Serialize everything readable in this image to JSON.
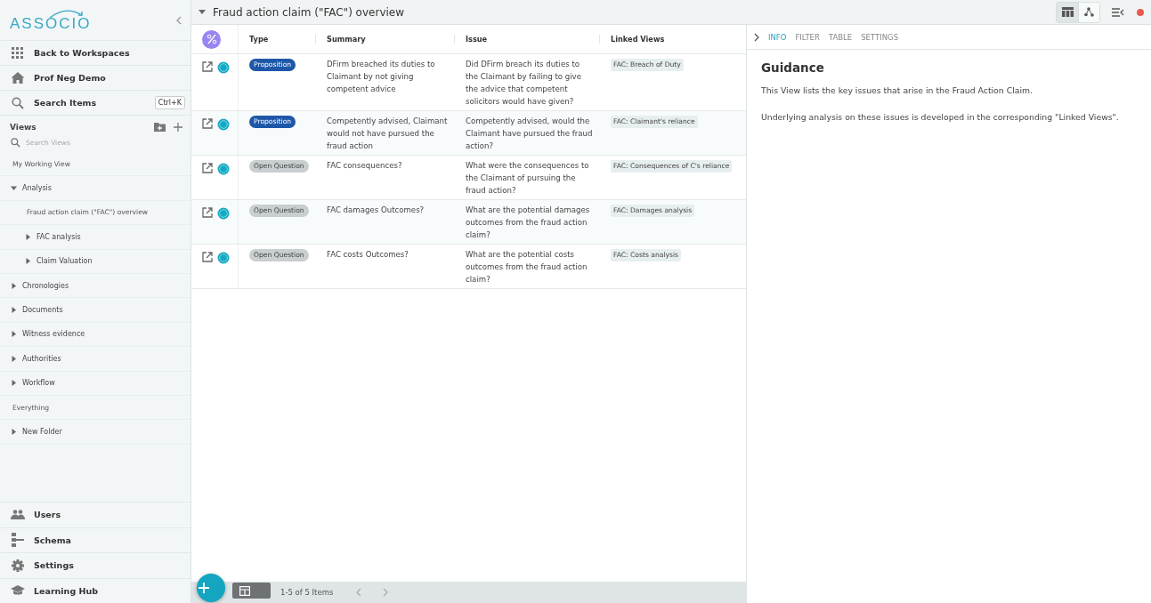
{
  "sidebar": {
    "logo": "ASSOCIO",
    "nav": [
      {
        "label": "Back to Workspaces",
        "kind": "grid"
      },
      {
        "label": "Prof Neg Demo",
        "kind": "home"
      },
      {
        "label": "Search Items",
        "kind": "search",
        "shortcut": "Ctrl+K"
      }
    ],
    "views_title": "Views",
    "views_search": {
      "placeholder": "Search Views"
    },
    "tree": [
      {
        "label": "My Working View",
        "kind": "view"
      },
      {
        "label": "Analysis",
        "kind": "folder",
        "expanded": true,
        "children": [
          {
            "label": "Fraud action claim (\"FAC\") overview",
            "kind": "view"
          },
          {
            "label": "FAC analysis",
            "kind": "folder",
            "expanded": false
          },
          {
            "label": "Claim Valuation",
            "kind": "folder",
            "expanded": false
          }
        ]
      },
      {
        "label": "Chronologies",
        "kind": "folder",
        "expanded": false
      },
      {
        "label": "Documents",
        "kind": "folder",
        "expanded": false
      },
      {
        "label": "Witness evidence",
        "kind": "folder",
        "expanded": false
      },
      {
        "label": "Authorities",
        "kind": "folder",
        "expanded": false
      },
      {
        "label": "Workflow",
        "kind": "folder",
        "expanded": false
      },
      {
        "label": "Everything",
        "kind": "view"
      },
      {
        "label": "New Folder",
        "kind": "folder",
        "expanded": false
      }
    ],
    "bottom": [
      {
        "label": "Users",
        "kind": "users"
      },
      {
        "label": "Schema",
        "kind": "schema"
      },
      {
        "label": "Settings",
        "kind": "settings"
      },
      {
        "label": "Learning Hub",
        "kind": "hub"
      }
    ]
  },
  "view": {
    "title": "Fraud action claim (\"FAC\") overview",
    "toolbar": [
      {
        "kind": "table",
        "selected": true
      },
      {
        "kind": "graph",
        "selected": false
      }
    ]
  },
  "table": {
    "columns": [
      "Type",
      "Summary",
      "Issue",
      "Linked Views"
    ],
    "rows": [
      {
        "type": "Proposition",
        "kind": "proposition",
        "summary": "DFirm breached its duties to Claimant by not giving competent advice",
        "issue": "Did DFirm breach its duties to the Claimant by failing to give the advice that competent solicitors would have given?",
        "linked": "FAC: Breach of Duty"
      },
      {
        "type": "Proposition",
        "kind": "proposition",
        "summary": "Competently advised, Claimant would not have pursued the fraud action",
        "issue": "Competently advised, would the Claimant have pursued the fraud action?",
        "linked": "FAC: Claimant's reliance"
      },
      {
        "type": "Open Question",
        "kind": "question",
        "summary": "FAC consequences?",
        "issue": "What were the consequences to the Claimant of pursuing the fraud action?",
        "linked": "FAC: Consequences of C's reliance"
      },
      {
        "type": "Open Question",
        "kind": "question",
        "summary": "FAC damages Outcomes?",
        "issue": "What are the potential damages outcomes from the fraud action claim?",
        "linked": "FAC: Damages analysis"
      },
      {
        "type": "Open Question",
        "kind": "question",
        "summary": "FAC costs Outcomes?",
        "issue": "What are the potential costs outcomes from the fraud action claim?",
        "linked": "FAC: Costs analysis"
      }
    ],
    "pager": "1-5 of 5 Items"
  },
  "panel": {
    "tabs": [
      {
        "label": "INFO",
        "selected": true
      },
      {
        "label": "FILTER",
        "selected": false
      },
      {
        "label": "TABLE",
        "selected": false
      },
      {
        "label": "SETTINGS",
        "selected": false
      }
    ],
    "heading": "Guidance",
    "paragraphs": [
      "This View lists the key issues that arise in the Fraud Action Claim.",
      "Underlying analysis on these issues is developed in the corresponding \"Linked Views\"."
    ]
  }
}
